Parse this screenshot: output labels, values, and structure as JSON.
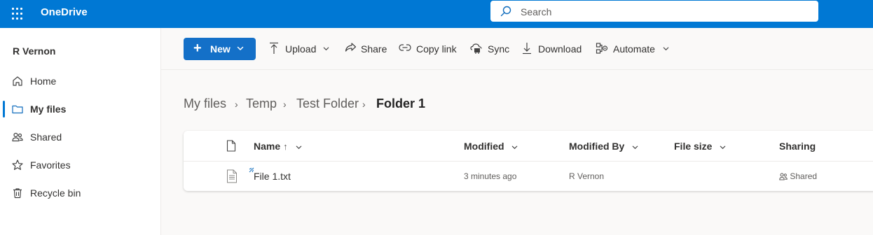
{
  "header": {
    "app_name": "OneDrive",
    "search_placeholder": "Search",
    "brand_color": "#0078d4"
  },
  "sidebar": {
    "user_name": "R Vernon",
    "items": [
      {
        "label": "Home",
        "icon": "home-icon",
        "active": false
      },
      {
        "label": "My files",
        "icon": "folder-icon",
        "active": true
      },
      {
        "label": "Shared",
        "icon": "people-icon",
        "active": false
      },
      {
        "label": "Favorites",
        "icon": "star-icon",
        "active": false
      },
      {
        "label": "Recycle bin",
        "icon": "trash-icon",
        "active": false
      }
    ]
  },
  "toolbar": {
    "new_label": "New",
    "upload_label": "Upload",
    "share_label": "Share",
    "copy_link_label": "Copy link",
    "sync_label": "Sync",
    "download_label": "Download",
    "automate_label": "Automate"
  },
  "breadcrumb": {
    "items": [
      "My files",
      "Temp",
      "Test Folder"
    ],
    "current": "Folder 1"
  },
  "file_list": {
    "columns": {
      "name": "Name",
      "name_sort_indicator": "↑",
      "modified": "Modified",
      "modified_by": "Modified By",
      "file_size": "File size",
      "sharing": "Sharing"
    },
    "rows": [
      {
        "name": "File 1.txt",
        "modified": "3 minutes ago",
        "modified_by": "R Vernon",
        "file_size": "",
        "sharing": "Shared"
      }
    ]
  }
}
